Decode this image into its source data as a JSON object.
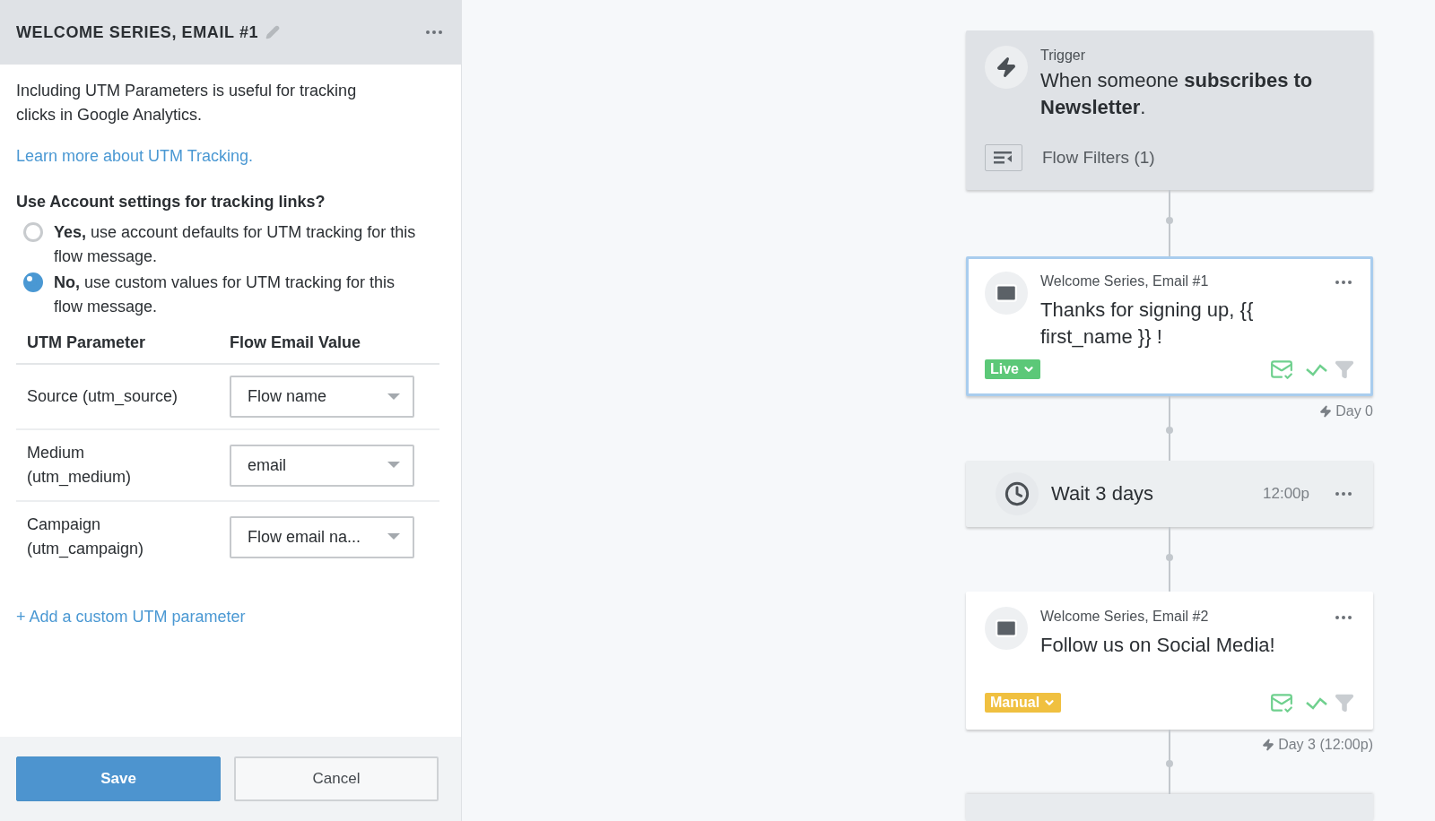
{
  "panel": {
    "title": "WELCOME SERIES, EMAIL #1",
    "description": "Including UTM Parameters is useful for tracking clicks in Google Analytics.",
    "learn_link": "Learn more about UTM Tracking.",
    "question": "Use Account settings for tracking links?",
    "options": [
      {
        "label": "**Yes,** use account defaults for UTM tracking for this flow message.",
        "selected": false
      },
      {
        "label": "**No,** use custom values for UTM tracking for this flow message.",
        "selected": true
      }
    ],
    "table": {
      "columns": [
        "UTM Parameter",
        "Flow Email Value"
      ],
      "rows": [
        {
          "parameter": "Source (utm_source)",
          "value": "Flow name"
        },
        {
          "parameter": "Medium (utm_medium)",
          "value": "email"
        },
        {
          "parameter": "Campaign (utm_campaign)",
          "value": "Flow email na..."
        }
      ]
    },
    "add_link": "+ Add a custom UTM parameter",
    "buttons": {
      "save": "Save",
      "cancel": "Cancel"
    }
  },
  "flow": {
    "trigger": {
      "label": "Trigger",
      "text": "When someone **subscribes to Newsletter**.",
      "filters": "Flow Filters (1)"
    },
    "nodes": [
      {
        "kind": "email",
        "title": "Welcome Series, Email #1",
        "subject": "Thanks for signing up, {{ first_name }} !",
        "status": "Live",
        "color": "#5cc878",
        "selected": true,
        "timing": "Day 0"
      },
      {
        "kind": "wait",
        "label": "Wait 3 days",
        "time": "12:00p"
      },
      {
        "kind": "email",
        "title": "Welcome Series, Email #2",
        "subject": "Follow us on Social Media!",
        "status": "Manual",
        "color": "#f0c040",
        "selected": false,
        "timing": "Day 3 (12:00p)"
      }
    ]
  }
}
